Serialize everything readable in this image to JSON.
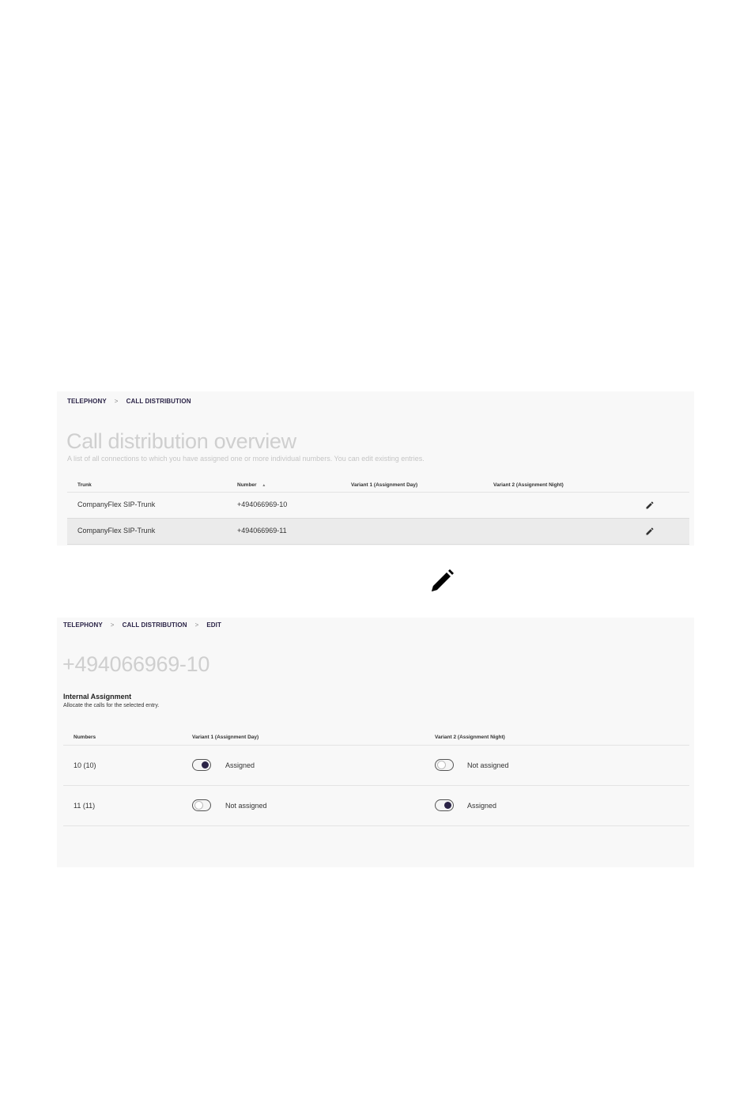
{
  "overview": {
    "breadcrumb": [
      "TELEPHONY",
      "CALL DISTRIBUTION"
    ],
    "breadcrumb_separator": ">",
    "title": "Call distribution overview",
    "subtitle": "A list of all connections to which you have assigned one or more individual numbers. You can edit existing entries.",
    "columns": {
      "trunk": "Trunk",
      "number": "Number",
      "number_sort": "▲",
      "variant1": "Variant 1 (Assignment Day)",
      "variant2": "Variant 2 (Assignment Night)"
    },
    "rows": [
      {
        "trunk": "CompanyFlex SIP-Trunk",
        "number": "+494066969-10",
        "edit_icon": "pencil-icon"
      },
      {
        "trunk": "CompanyFlex SIP-Trunk",
        "number": "+494066969-11",
        "edit_icon": "pencil-icon"
      }
    ]
  },
  "step_icon": "pencil-icon",
  "edit": {
    "breadcrumb": [
      "TELEPHONY",
      "CALL DISTRIBUTION",
      "EDIT"
    ],
    "breadcrumb_separator": ">",
    "title": "+494066969-10",
    "section_title": "Internal Assignment",
    "section_desc": "Allocate the calls for the selected entry.",
    "columns": {
      "numbers": "Numbers",
      "variant1": "Variant 1 (Assignment Day)",
      "variant2": "Variant 2 (Assignment Night)"
    },
    "rows": [
      {
        "number": "10 (10)",
        "v1_on": true,
        "v1_label": "Assigned",
        "v2_on": false,
        "v2_label": "Not assigned"
      },
      {
        "number": "11 (11)",
        "v1_on": false,
        "v1_label": "Not assigned",
        "v2_on": true,
        "v2_label": "Assigned"
      }
    ]
  },
  "colors": {
    "accent": "#2b2447",
    "panel_bg": "#f8f8f8",
    "highlight_row": "#ebebeb",
    "title_grey": "#cfcfcf"
  }
}
